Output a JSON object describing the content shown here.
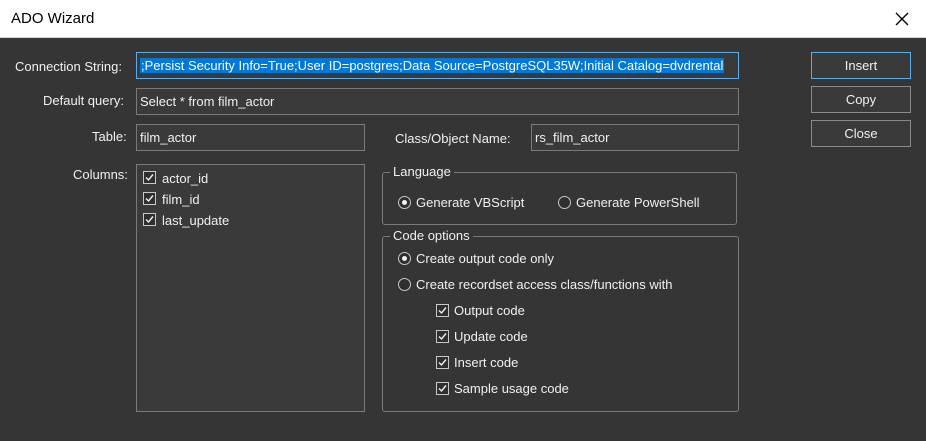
{
  "window": {
    "title": "ADO Wizard"
  },
  "labels": {
    "connection_string": "Connection String:",
    "default_query": "Default query:",
    "table": "Table:",
    "columns": "Columns:",
    "class_object_name": "Class/Object Name:"
  },
  "fields": {
    "connection_string_prefix": ";",
    "connection_string": "Persist Security Info=True;User ID=postgres;Data Source=PostgreSQL35W;Initial Catalog=dvdrental",
    "default_query": "Select * from film_actor",
    "table": "film_actor",
    "class_object_name": "rs_film_actor"
  },
  "buttons": {
    "insert": "Insert",
    "copy": "Copy",
    "close": "Close"
  },
  "columns": [
    {
      "label": "actor_id",
      "checked": true
    },
    {
      "label": "film_id",
      "checked": true
    },
    {
      "label": "last_update",
      "checked": true
    }
  ],
  "language": {
    "title": "Language",
    "options": [
      {
        "label": "Generate VBScript",
        "selected": true
      },
      {
        "label": "Generate PowerShell",
        "selected": false
      }
    ]
  },
  "code_options": {
    "title": "Code options",
    "radios": [
      {
        "label": "Create output code only",
        "selected": true
      },
      {
        "label": "Create recordset access class/functions with",
        "selected": false
      }
    ],
    "checks": [
      {
        "label": "Output code",
        "checked": true
      },
      {
        "label": "Update code",
        "checked": true
      },
      {
        "label": "Insert code",
        "checked": true
      },
      {
        "label": "Sample usage code",
        "checked": true
      }
    ]
  },
  "icons": {
    "close": "close-icon",
    "check": "checkmark-icon"
  }
}
